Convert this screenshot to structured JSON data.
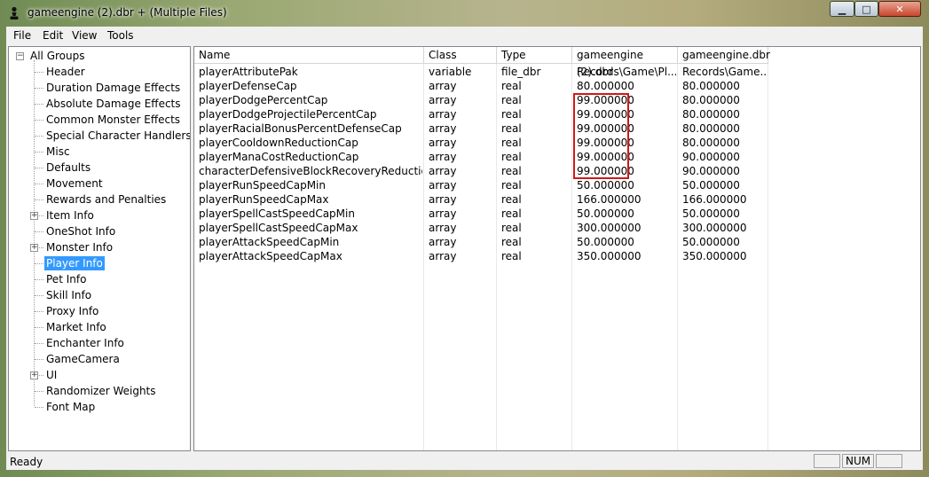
{
  "window": {
    "title": "gameengine (2).dbr + (Multiple Files)",
    "minimize_glyph": "▁",
    "maximize_glyph": "□",
    "close_glyph": "✕"
  },
  "menu": [
    "File",
    "Edit",
    "View",
    "Tools"
  ],
  "tree": {
    "root": "All Groups",
    "root_expander": "−",
    "items": [
      {
        "label": "Header",
        "expander": ""
      },
      {
        "label": "Duration Damage Effects",
        "expander": ""
      },
      {
        "label": "Absolute Damage Effects",
        "expander": ""
      },
      {
        "label": "Common Monster Effects",
        "expander": ""
      },
      {
        "label": "Special Character Handlers",
        "expander": ""
      },
      {
        "label": "Misc",
        "expander": ""
      },
      {
        "label": "Defaults",
        "expander": ""
      },
      {
        "label": "Movement",
        "expander": ""
      },
      {
        "label": "Rewards and Penalties",
        "expander": ""
      },
      {
        "label": "Item Info",
        "expander": "+"
      },
      {
        "label": "OneShot Info",
        "expander": ""
      },
      {
        "label": "Monster Info",
        "expander": "+"
      },
      {
        "label": "Player Info",
        "expander": "",
        "selected": true
      },
      {
        "label": "Pet Info",
        "expander": ""
      },
      {
        "label": "Skill Info",
        "expander": ""
      },
      {
        "label": "Proxy Info",
        "expander": ""
      },
      {
        "label": "Market Info",
        "expander": ""
      },
      {
        "label": "Enchanter Info",
        "expander": ""
      },
      {
        "label": "GameCamera",
        "expander": ""
      },
      {
        "label": "UI",
        "expander": "+"
      },
      {
        "label": "Randomizer Weights",
        "expander": ""
      },
      {
        "label": "Font Map",
        "expander": ""
      }
    ]
  },
  "table": {
    "columns": [
      "Name",
      "Class",
      "Type",
      "gameengine (2).dbr",
      "gameengine.dbr"
    ],
    "rows": [
      [
        "playerAttributePak",
        "variable",
        "file_dbr",
        "Records\\Game\\Pl...",
        "Records\\Game..."
      ],
      [
        "playerDefenseCap",
        "array",
        "real",
        "80.000000",
        "80.000000"
      ],
      [
        "playerDodgePercentCap",
        "array",
        "real",
        "99.000000",
        "80.000000"
      ],
      [
        "playerDodgeProjectilePercentCap",
        "array",
        "real",
        "99.000000",
        "80.000000"
      ],
      [
        "playerRacialBonusPercentDefenseCap",
        "array",
        "real",
        "99.000000",
        "80.000000"
      ],
      [
        "playerCooldownReductionCap",
        "array",
        "real",
        "99.000000",
        "80.000000"
      ],
      [
        "playerManaCostReductionCap",
        "array",
        "real",
        "99.000000",
        "90.000000"
      ],
      [
        "characterDefensiveBlockRecoveryReductionCap",
        "array",
        "real",
        "99.000000",
        "90.000000"
      ],
      [
        "playerRunSpeedCapMin",
        "array",
        "real",
        "50.000000",
        "50.000000"
      ],
      [
        "playerRunSpeedCapMax",
        "array",
        "real",
        "166.000000",
        "166.000000"
      ],
      [
        "playerSpellCastSpeedCapMin",
        "array",
        "real",
        "50.000000",
        "50.000000"
      ],
      [
        "playerSpellCastSpeedCapMax",
        "array",
        "real",
        "300.000000",
        "300.000000"
      ],
      [
        "playerAttackSpeedCapMin",
        "array",
        "real",
        "50.000000",
        "50.000000"
      ],
      [
        "playerAttackSpeedCapMax",
        "array",
        "real",
        "350.000000",
        "350.000000"
      ]
    ],
    "highlight_color": "#d01818"
  },
  "status": {
    "text": "Ready",
    "num": "NUM"
  }
}
